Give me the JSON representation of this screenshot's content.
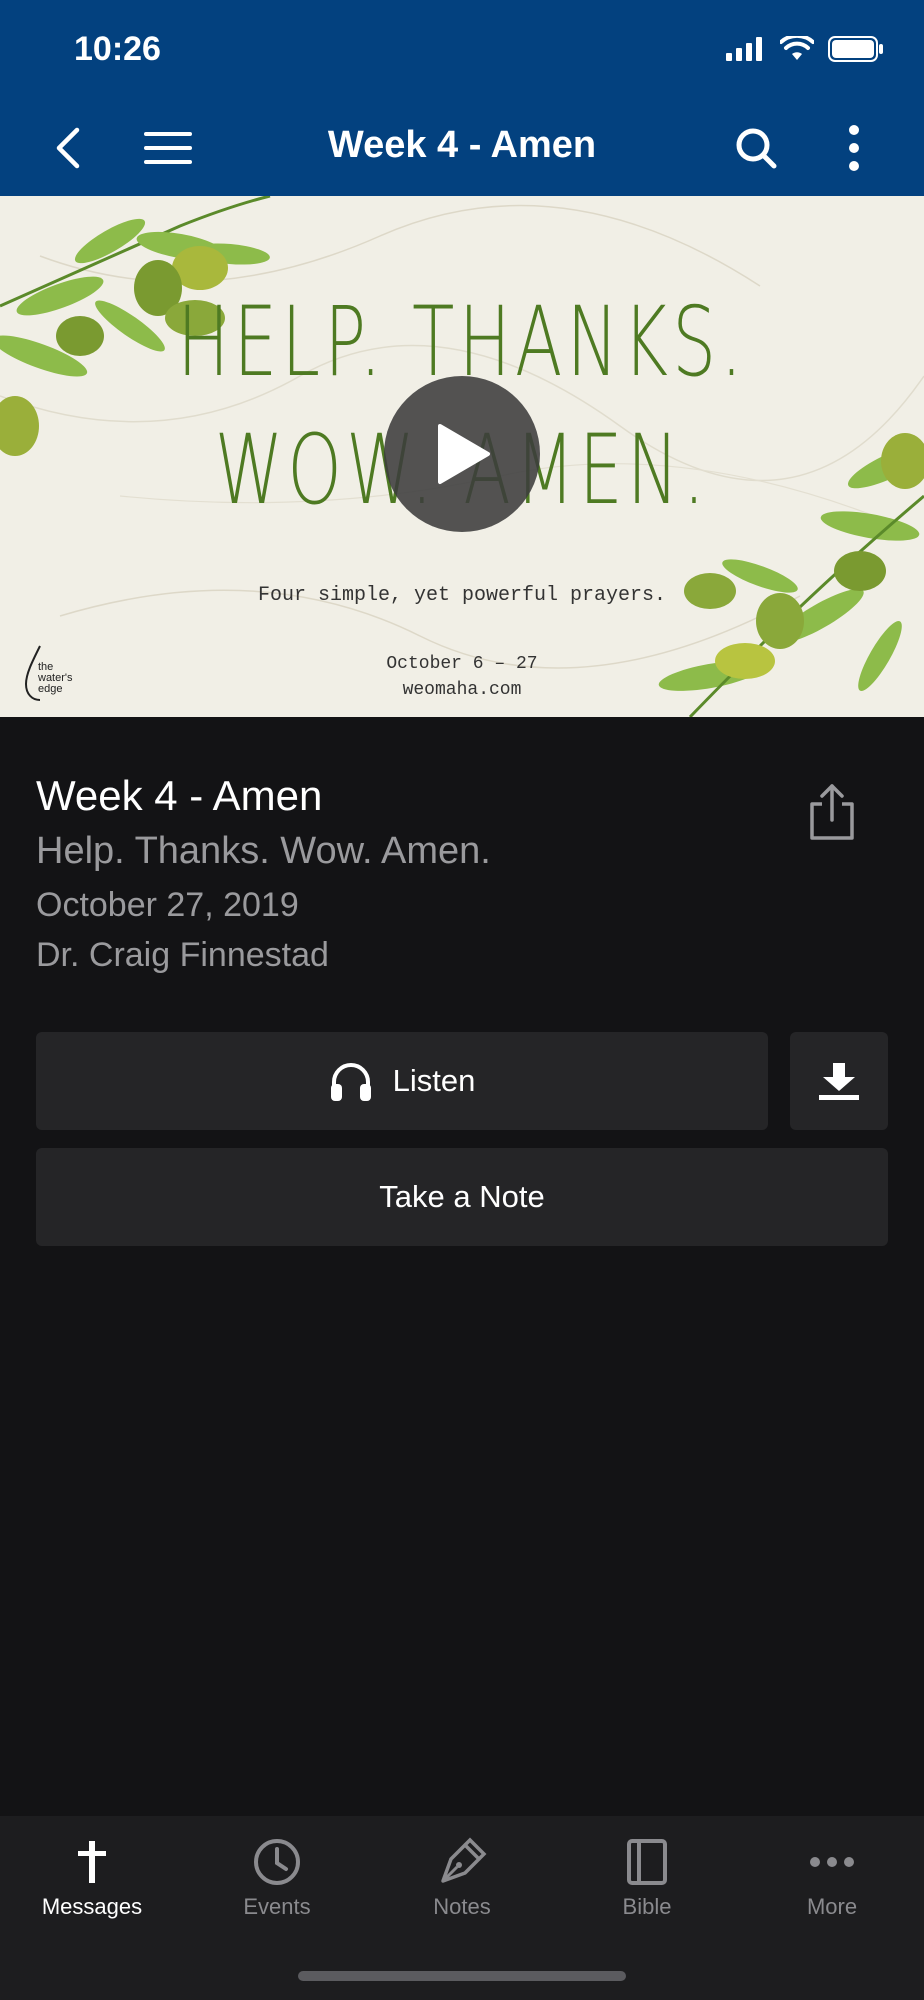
{
  "status": {
    "time": "10:26"
  },
  "header": {
    "title": "Week 4 - Amen",
    "icons": [
      "back-arrow-icon",
      "menu-icon",
      "search-icon",
      "more-vertical-icon"
    ]
  },
  "hero": {
    "line1": "HELP. THANKS.",
    "line2": "WOW. AMEN.",
    "tagline": "Four simple, yet powerful prayers.",
    "dates": "October 6 – 27",
    "site": "weomaha.com",
    "logo_text": "the water's edge"
  },
  "message": {
    "title": "Week 4 - Amen",
    "series": "Help. Thanks. Wow. Amen.",
    "date": "October 27, 2019",
    "speaker": "Dr. Craig Finnestad"
  },
  "actions": {
    "listen_label": "Listen",
    "note_label": "Take a Note"
  },
  "tabs": [
    {
      "label": "Messages",
      "icon": "cross-icon",
      "active": true
    },
    {
      "label": "Events",
      "icon": "clock-icon",
      "active": false
    },
    {
      "label": "Notes",
      "icon": "pen-icon",
      "active": false
    },
    {
      "label": "Bible",
      "icon": "book-icon",
      "active": false
    },
    {
      "label": "More",
      "icon": "more-horizontal-icon",
      "active": false
    }
  ],
  "colors": {
    "header": "#03417f",
    "background": "#131315",
    "button": "#252527",
    "tabbar": "#1d1d1f",
    "accent_green": "#4e7a22"
  }
}
